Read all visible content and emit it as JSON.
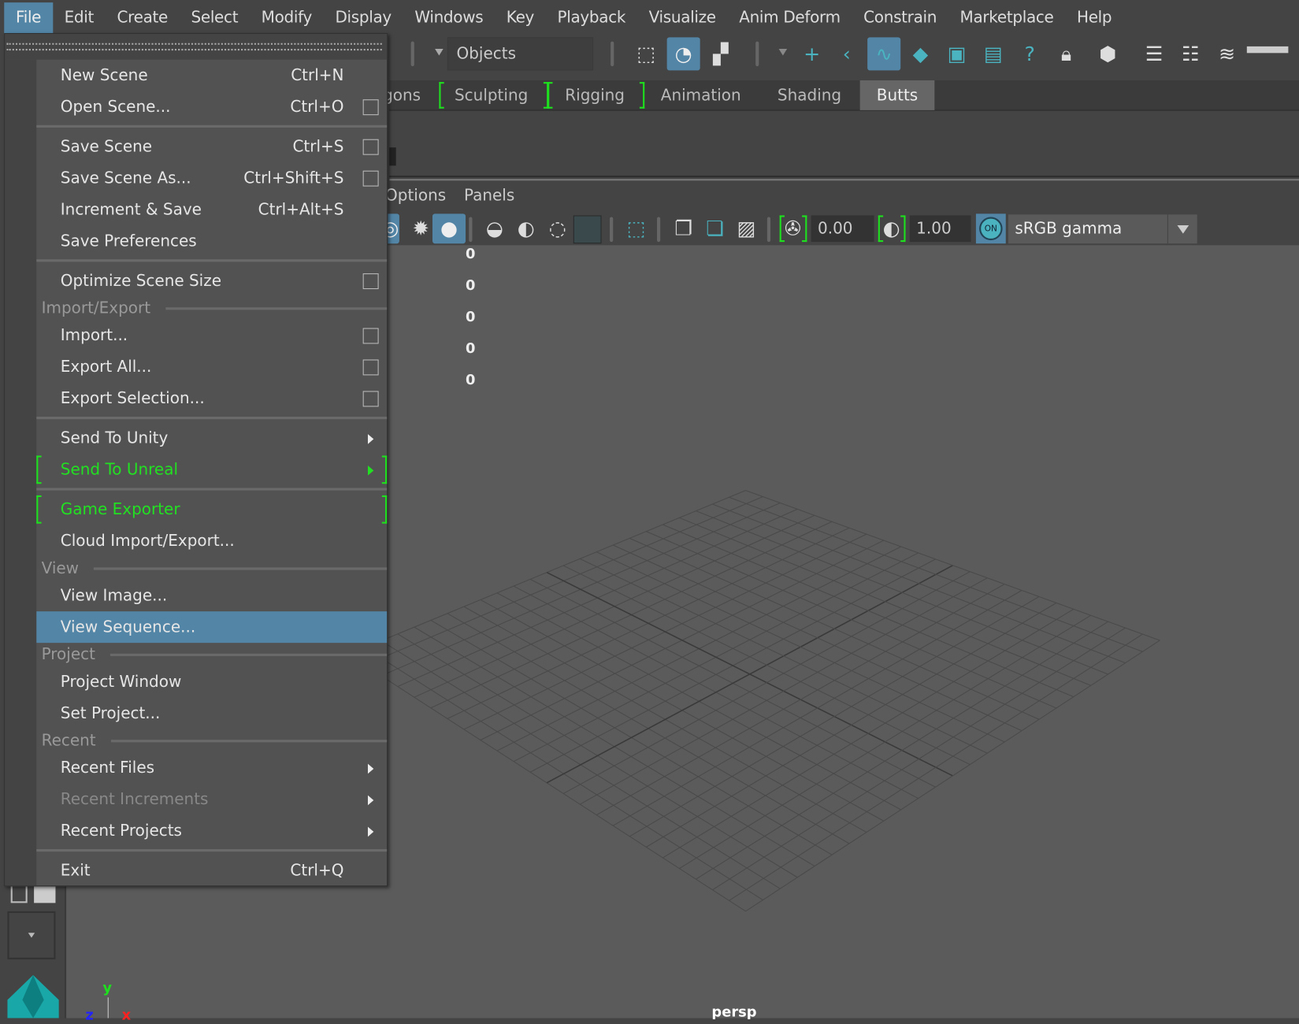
{
  "menubar": {
    "items": [
      "File",
      "Edit",
      "Create",
      "Select",
      "Modify",
      "Display",
      "Windows",
      "Key",
      "Playback",
      "Visualize",
      "Anim Deform",
      "Constrain",
      "Marketplace",
      "Help"
    ],
    "active": "File"
  },
  "toolbar": {
    "selection_mode": "Objects"
  },
  "shelf": {
    "tabs": [
      "gons",
      "Sculpting",
      "Rigging",
      "Animation",
      "Shading",
      "Butts"
    ],
    "active": "Butts"
  },
  "panel_menu": [
    "Options",
    "Panels"
  ],
  "viewport_toolbar": {
    "exposure": "0.00",
    "gamma": "1.00",
    "color_space": "sRGB gamma",
    "toggle_label": "ON"
  },
  "hud_values": [
    "0",
    "0",
    "0",
    "0",
    "0"
  ],
  "viewport": {
    "camera": "persp",
    "axes": {
      "x": "x",
      "y": "y",
      "z": "z"
    }
  },
  "file_menu": {
    "items": [
      {
        "type": "item",
        "label": "New Scene",
        "shortcut": "Ctrl+N"
      },
      {
        "type": "item",
        "label": "Open Scene...",
        "shortcut": "Ctrl+O",
        "option_box": true
      },
      {
        "type": "sep"
      },
      {
        "type": "item",
        "label": "Save Scene",
        "shortcut": "Ctrl+S",
        "option_box": true
      },
      {
        "type": "item",
        "label": "Save Scene As...",
        "shortcut": "Ctrl+Shift+S",
        "option_box": true
      },
      {
        "type": "item",
        "label": "Increment & Save",
        "shortcut": "Ctrl+Alt+S"
      },
      {
        "type": "item",
        "label": "Save Preferences"
      },
      {
        "type": "sep"
      },
      {
        "type": "item",
        "label": "Optimize Scene Size",
        "option_box": true
      },
      {
        "type": "section",
        "label": "Import/Export"
      },
      {
        "type": "item",
        "label": "Import...",
        "option_box": true
      },
      {
        "type": "item",
        "label": "Export All...",
        "option_box": true
      },
      {
        "type": "item",
        "label": "Export Selection...",
        "option_box": true
      },
      {
        "type": "sep"
      },
      {
        "type": "item",
        "label": "Send To Unity",
        "submenu": true
      },
      {
        "type": "item",
        "label": "Send To Unreal",
        "submenu": true,
        "highlight_color": "#22e022"
      },
      {
        "type": "sep"
      },
      {
        "type": "item",
        "label": "Game Exporter",
        "highlight_color": "#22e022"
      },
      {
        "type": "item",
        "label": "Cloud Import/Export..."
      },
      {
        "type": "section",
        "label": "View"
      },
      {
        "type": "item",
        "label": "View Image..."
      },
      {
        "type": "item",
        "label": "View Sequence...",
        "hovered": true
      },
      {
        "type": "section",
        "label": "Project"
      },
      {
        "type": "item",
        "label": "Project Window"
      },
      {
        "type": "item",
        "label": "Set Project..."
      },
      {
        "type": "section",
        "label": "Recent"
      },
      {
        "type": "item",
        "label": "Recent Files",
        "submenu": true
      },
      {
        "type": "item",
        "label": "Recent Increments",
        "submenu": true,
        "disabled": true
      },
      {
        "type": "item",
        "label": "Recent Projects",
        "submenu": true
      },
      {
        "type": "sep"
      },
      {
        "type": "item",
        "label": "Exit",
        "shortcut": "Ctrl+Q"
      }
    ]
  },
  "colors": {
    "accent": "#5285a6",
    "marker_green": "#22e022",
    "icon_teal": "#4ab3bf"
  }
}
